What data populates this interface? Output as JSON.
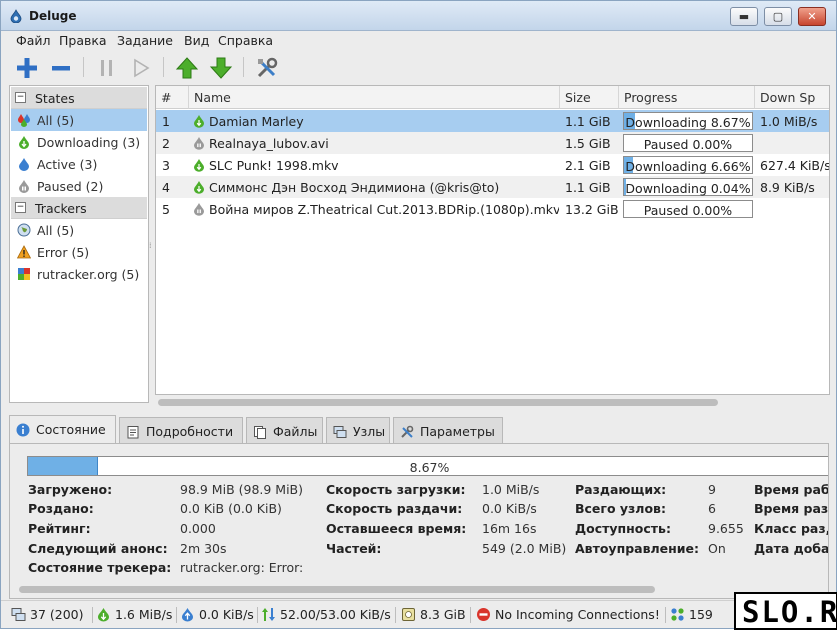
{
  "window": {
    "title": "Deluge"
  },
  "menu": [
    "Файл",
    "Правка",
    "Задание",
    "Вид",
    "Справка"
  ],
  "toolbar": {
    "icons": [
      "add-icon",
      "remove-icon",
      "pause-icon",
      "resume-icon",
      "queue-up-icon",
      "queue-down-icon",
      "preferences-icon"
    ]
  },
  "sidebar": {
    "states_header": "States",
    "states": [
      {
        "label": "All (5)",
        "icon": "all-icon",
        "selected": true
      },
      {
        "label": "Downloading (3)",
        "icon": "downloading-icon"
      },
      {
        "label": "Active (3)",
        "icon": "active-icon"
      },
      {
        "label": "Paused (2)",
        "icon": "paused-icon"
      }
    ],
    "trackers_header": "Trackers",
    "trackers": [
      {
        "label": "All (5)",
        "icon": "globe-icon"
      },
      {
        "label": "Error (5)",
        "icon": "warning-icon"
      },
      {
        "label": "rutracker.org (5)",
        "icon": "tracker-icon"
      }
    ]
  },
  "torrent_list": {
    "columns": [
      "#",
      "Name",
      "Size",
      "Progress",
      "Down Sp"
    ],
    "rows": [
      {
        "num": "1",
        "name": "Damian Marley",
        "size": "1.1 GiB",
        "progress_text": "Downloading 8.67%",
        "progress": 0.0867,
        "down": "1.0 MiB/s",
        "state": "downloading",
        "selected": true
      },
      {
        "num": "2",
        "name": "Realnaya_lubov.avi",
        "size": "1.5 GiB",
        "progress_text": "Paused 0.00%",
        "progress": 0.0,
        "down": "",
        "state": "paused"
      },
      {
        "num": "3",
        "name": "SLC Punk! 1998.mkv",
        "size": "2.1 GiB",
        "progress_text": "Downloading 6.66%",
        "progress": 0.0666,
        "down": "627.4 KiB/s",
        "state": "downloading"
      },
      {
        "num": "4",
        "name": "Симмонс Дэн Восход Эндимиона (@kris@to)",
        "size": "1.1 GiB",
        "progress_text": "Downloading 0.04%",
        "progress": 0.0004,
        "down": "8.9 KiB/s",
        "state": "downloading"
      },
      {
        "num": "5",
        "name": "Война миров Z.Theatrical Cut.2013.BDRip.(1080p).mkv",
        "size": "13.2 GiB",
        "progress_text": "Paused 0.00%",
        "progress": 0.0,
        "down": "",
        "state": "paused"
      }
    ]
  },
  "tabs": [
    {
      "label": "Состояние",
      "icon": "info-icon",
      "active": true
    },
    {
      "label": "Подробности",
      "icon": "details-icon"
    },
    {
      "label": "Файлы",
      "icon": "files-icon"
    },
    {
      "label": "Узлы",
      "icon": "peers-icon"
    },
    {
      "label": "Параметры",
      "icon": "options-icon"
    }
  ],
  "status_panel": {
    "progress_text": "8.67%",
    "progress": 0.0867,
    "col1": [
      {
        "label": "Загружено:",
        "value": "98.9 MiB (98.9 MiB)"
      },
      {
        "label": "Роздано:",
        "value": "0.0 KiB (0.0 KiB)"
      },
      {
        "label": "Рейтинг:",
        "value": "0.000"
      },
      {
        "label": "Следующий анонс:",
        "value": "2m 30s"
      },
      {
        "label": "Состояние трекера:",
        "value": "rutracker.org: Error:"
      }
    ],
    "col2": [
      {
        "label": "Скорость загрузки:",
        "value": "1.0 MiB/s"
      },
      {
        "label": "Скорость раздачи:",
        "value": "0.0 KiB/s"
      },
      {
        "label": "Оставшееся время:",
        "value": "16m 16s"
      },
      {
        "label": "Частей:",
        "value": "549 (2.0 MiB)"
      }
    ],
    "col3": [
      {
        "label": "Раздающих:",
        "value": "9"
      },
      {
        "label": "Всего узлов:",
        "value": "6"
      },
      {
        "label": "Доступность:",
        "value": "9.655"
      },
      {
        "label": "Автоуправление:",
        "value": "On"
      }
    ],
    "col4": [
      {
        "label": "Время раб"
      },
      {
        "label": "Время раз"
      },
      {
        "label": "Класс раз,"
      },
      {
        "label": "Дата доба"
      }
    ]
  },
  "statusbar": {
    "connections": "37 (200)",
    "download": "1.6 MiB/s",
    "upload": "0.0 KiB/s",
    "protocol": "52.00/53.00 KiB/s",
    "disk": "8.3 GiB",
    "incoming": "No Incoming Connections!",
    "dht": "159"
  },
  "logo": {
    "text": "SLO.RU"
  }
}
